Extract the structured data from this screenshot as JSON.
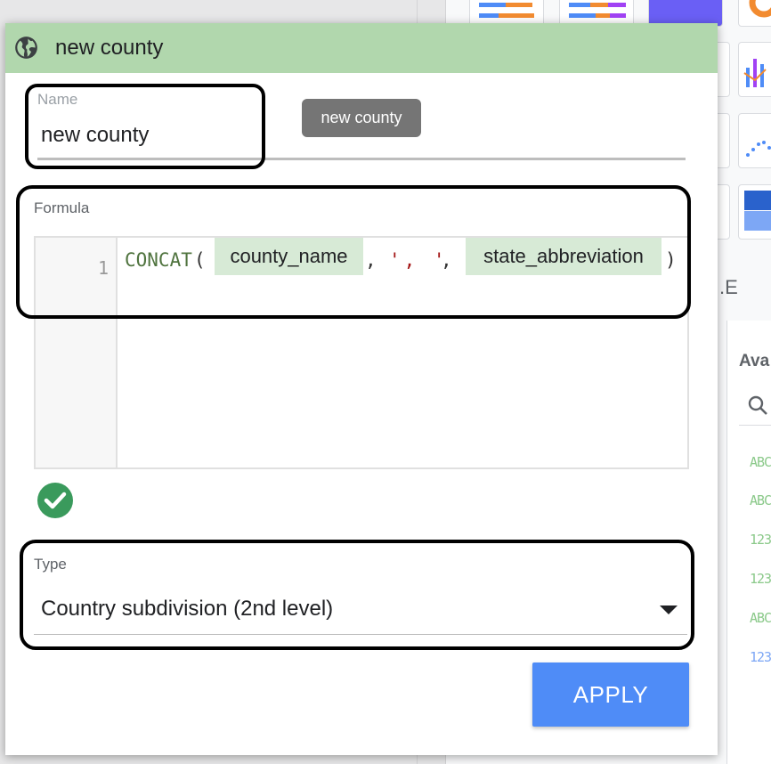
{
  "dialog": {
    "title": "new county",
    "header_icon": "globe-icon",
    "header_color": "#b1d7ad"
  },
  "name_field": {
    "label": "Name",
    "value": "new county",
    "chip": "new county"
  },
  "formula": {
    "label": "Formula",
    "line_number": "1",
    "function_name": "CONCAT",
    "open_paren": "(",
    "field_1": "county_name",
    "comma_1": ",",
    "string_arg": "', '",
    "comma_2": ",",
    "field_2": "state_abbreviation",
    "close_paren": ")",
    "valid_icon": "check-circle-icon"
  },
  "type_field": {
    "label": "Type",
    "value": "Country subdivision (2nd level)",
    "arrow_icon": "dropdown-arrow-icon"
  },
  "apply_button": {
    "label": "APPLY",
    "color": "#4f8cf7"
  },
  "background": {
    "panel_heading": "Ava",
    "partial_label": ".E",
    "field_type_badges": [
      "ABC",
      "ABC",
      "123",
      "123",
      "ABC",
      "123"
    ],
    "search_icon": "search-icon"
  }
}
